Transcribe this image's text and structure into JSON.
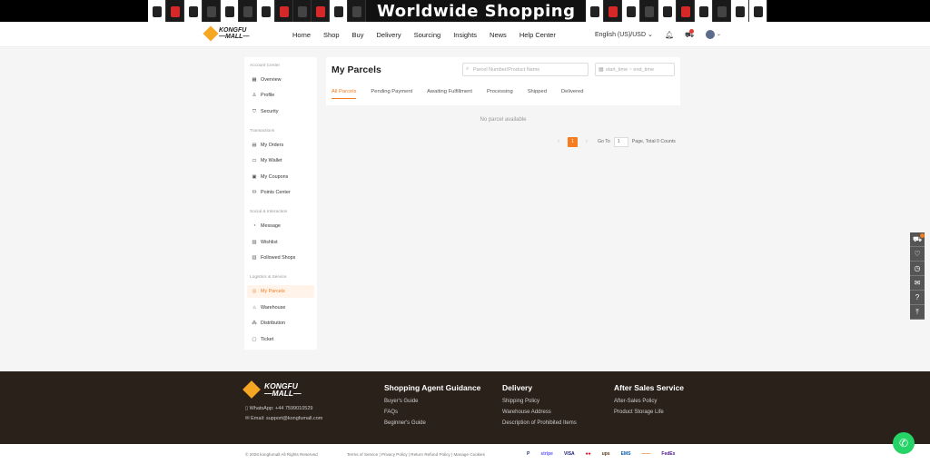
{
  "banner": {
    "title": "Worldwide Shopping"
  },
  "header": {
    "logo_top": "KONGFU",
    "logo_bottom": "—MALL—",
    "nav": [
      "Home",
      "Shop",
      "Buy",
      "Delivery",
      "Sourcing",
      "Insights",
      "News",
      "Help Center"
    ],
    "language": "English (US)/USD"
  },
  "sidebar": {
    "sections": [
      {
        "title": "Account Center",
        "items": [
          "Overview",
          "Profile",
          "Security"
        ]
      },
      {
        "title": "Transactions",
        "items": [
          "My Orders",
          "My Wallet",
          "My Coupons",
          "Points Center"
        ]
      },
      {
        "title": "Social & Interaction",
        "items": [
          "Message",
          "Wishlist",
          "Followed Shops"
        ]
      },
      {
        "title": "Logistics & Service",
        "items": [
          "My Parcels",
          "Warehouse",
          "Distribution",
          "Ticket"
        ]
      }
    ],
    "active": "My Parcels"
  },
  "main": {
    "title": "My Parcels",
    "search_placeholder": "Parcel Number/Product Name",
    "date_placeholder": "start_time ~ end_time",
    "tabs": [
      "All Parcels",
      "Pending Payment",
      "Awaiting Fulfillment",
      "Processing",
      "Shipped",
      "Delivered"
    ],
    "active_tab": "All Parcels",
    "empty_text": "No parcel available"
  },
  "pagination": {
    "current_page": "1",
    "goto_label": "Go To",
    "goto_value": "1",
    "summary": "Page, Total 0 Counts"
  },
  "footer": {
    "whatsapp": "WhatsApp: +44 7599010529",
    "email": "Email: support@kongfumall.com",
    "columns": [
      {
        "title": "Shopping Agent Guidance",
        "links": [
          "Buyer's Guide",
          "FAQs",
          "Beginner's Guide"
        ]
      },
      {
        "title": "Delivery",
        "links": [
          "Shipping Policy",
          "Warehouse Address",
          "Description of Prohibited Items"
        ]
      },
      {
        "title": "After Sales Service",
        "links": [
          "After-Sales Policy",
          "Product Storage Life"
        ]
      }
    ],
    "copyright": "© 2026 kongfumall All Rights Reserved",
    "legal_links": "Terms of Service | Privacy Policy | Return Refund Policy | Manage Cookies",
    "payments": [
      "P",
      "stripe",
      "VISA",
      "●●",
      "ups",
      "EMS",
      "——",
      "FedEx"
    ]
  },
  "colors": {
    "accent": "#f57c1f",
    "footer_bg": "#2b211b",
    "whatsapp": "#25d366"
  }
}
